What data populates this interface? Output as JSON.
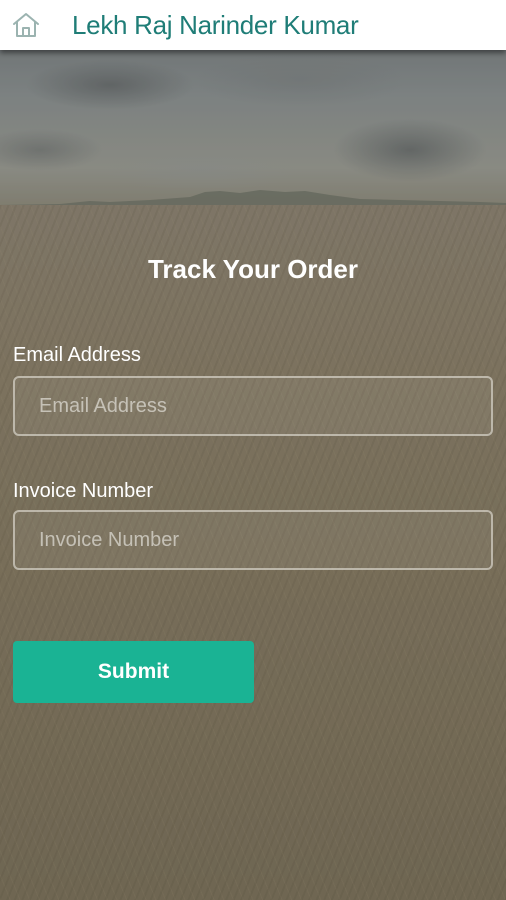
{
  "header": {
    "title": "Lekh Raj Narinder Kumar",
    "home_icon": "home-icon"
  },
  "form": {
    "heading": "Track Your Order",
    "email": {
      "label": "Email Address",
      "placeholder": "Email Address",
      "value": ""
    },
    "invoice": {
      "label": "Invoice Number",
      "placeholder": "Invoice Number",
      "value": ""
    },
    "submit_label": "Submit"
  },
  "colors": {
    "brand": "#1f7d77",
    "accent": "#1ab394",
    "appbar_background": "#ffffff"
  }
}
